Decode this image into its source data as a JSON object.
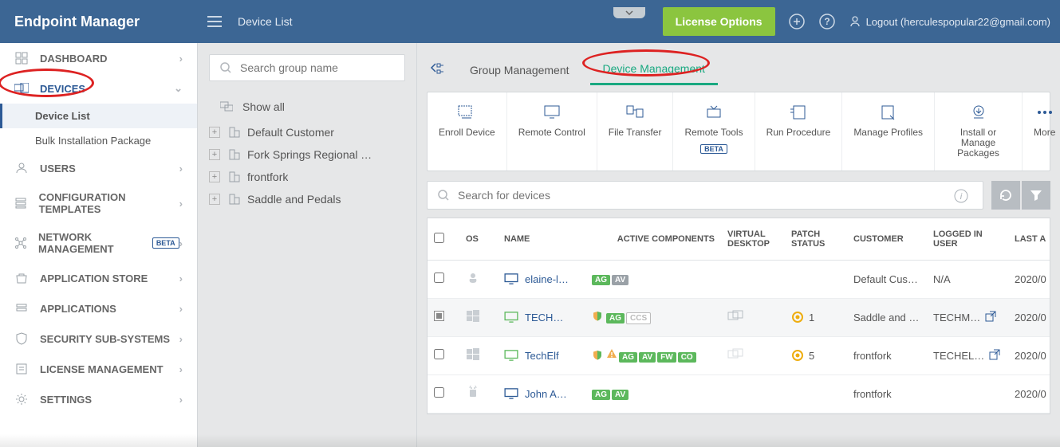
{
  "header": {
    "brand": "Endpoint Manager",
    "breadcrumb": "Device List",
    "licenseBtn": "License Options",
    "logoutLabel": "Logout (herculespopular22@gmail.com)"
  },
  "sidebar": {
    "items": [
      {
        "label": "DASHBOARD"
      },
      {
        "label": "DEVICES",
        "active": true,
        "sub": [
          {
            "label": "Device List",
            "active": true
          },
          {
            "label": "Bulk Installation Package"
          }
        ]
      },
      {
        "label": "USERS"
      },
      {
        "label": "CONFIGURATION TEMPLATES"
      },
      {
        "label": "NETWORK MANAGEMENT",
        "beta": "BETA"
      },
      {
        "label": "APPLICATION STORE"
      },
      {
        "label": "APPLICATIONS"
      },
      {
        "label": "SECURITY SUB-SYSTEMS"
      },
      {
        "label": "LICENSE MANAGEMENT"
      },
      {
        "label": "SETTINGS"
      }
    ]
  },
  "groupPanel": {
    "searchPlaceholder": "Search group name",
    "showAll": "Show all",
    "groups": [
      "Default Customer",
      "Fork Springs Regional Tr…",
      "frontfork",
      "Saddle and Pedals"
    ]
  },
  "tabs": {
    "group": "Group Management",
    "device": "Device Management"
  },
  "toolbar": {
    "enroll": "Enroll Device",
    "remote": "Remote Control",
    "file": "File Transfer",
    "tools": "Remote Tools",
    "beta": "BETA",
    "run": "Run Procedure",
    "profiles": "Manage Profiles",
    "install": "Install or Manage Packages",
    "more": "More"
  },
  "deviceSearchPlaceholder": "Search for devices",
  "tableHeaders": {
    "os": "OS",
    "name": "NAME",
    "active": "ACTIVE COMPONENTS",
    "vd": "VIRTUAL DESKTOP",
    "patch": "PATCH STATUS",
    "cust": "CUSTOMER",
    "user": "LOGGED IN USER",
    "last": "LAST A"
  },
  "rows": [
    {
      "name": "elaine-l…",
      "os": "linux",
      "screen": "blue",
      "chips": [
        "AG",
        "AV-grey"
      ],
      "shield": false,
      "warn": false,
      "vd": "",
      "patch": "",
      "cust": "Default Cust…",
      "user": "N/A",
      "ext": false,
      "last": "2020/0"
    },
    {
      "name": "TECH…",
      "os": "win",
      "screen": "green",
      "chips": [
        "AG",
        "CCS-outline"
      ],
      "shield": true,
      "warn": false,
      "vd": "yes",
      "patch": "1",
      "cust": "Saddle and …",
      "user": "TECHM…",
      "ext": true,
      "last": "2020/0"
    },
    {
      "name": "TechElf",
      "os": "win",
      "screen": "green",
      "chips": [
        "AG",
        "AV",
        "FW",
        "CO"
      ],
      "shield": true,
      "warn": true,
      "vd": "yes-grey",
      "patch": "5",
      "cust": "frontfork",
      "user": "TECHEL…",
      "ext": true,
      "last": "2020/0"
    },
    {
      "name": "John A…",
      "os": "android",
      "screen": "blue",
      "chips": [
        "AG",
        "AV"
      ],
      "shield": false,
      "warn": false,
      "vd": "",
      "patch": "",
      "cust": "frontfork",
      "user": "",
      "ext": false,
      "last": "2020/0"
    }
  ]
}
